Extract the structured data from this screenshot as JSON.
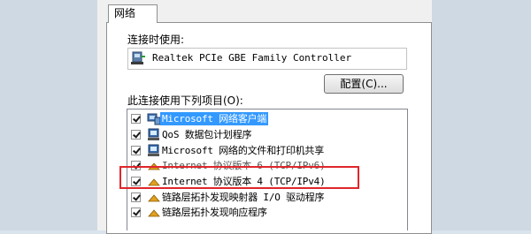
{
  "tab": {
    "label": "网络"
  },
  "connect_using": {
    "label": "连接时使用:",
    "adapter_name": "Realtek PCIe GBE Family Controller"
  },
  "configure_button": "配置(C)...",
  "items_label": "此连接使用下列项目(O):",
  "items": [
    {
      "label": "Microsoft 网络客户端",
      "checked": true,
      "icon": "network-client-icon",
      "selected": true
    },
    {
      "label": "QoS 数据包计划程序",
      "checked": true,
      "icon": "qos-scheduler-icon"
    },
    {
      "label": "Microsoft 网络的文件和打印机共享",
      "checked": true,
      "icon": "file-printer-sharing-icon"
    },
    {
      "label": "Internet 协议版本 6 (TCP/IPv6)",
      "checked": true,
      "icon": "protocol-icon"
    },
    {
      "label": "Internet 协议版本 4 (TCP/IPv4)",
      "checked": true,
      "icon": "protocol-icon",
      "highlighted": true
    },
    {
      "label": "链路层拓扑发现映射器 I/O 驱动程序",
      "checked": true,
      "icon": "protocol-icon"
    },
    {
      "label": "链路层拓扑发现响应程序",
      "checked": true,
      "icon": "protocol-icon"
    }
  ],
  "colors": {
    "selection": "#3399ff",
    "highlight_box": "#e0262b",
    "dialog_bg": "#f0f0f0"
  }
}
